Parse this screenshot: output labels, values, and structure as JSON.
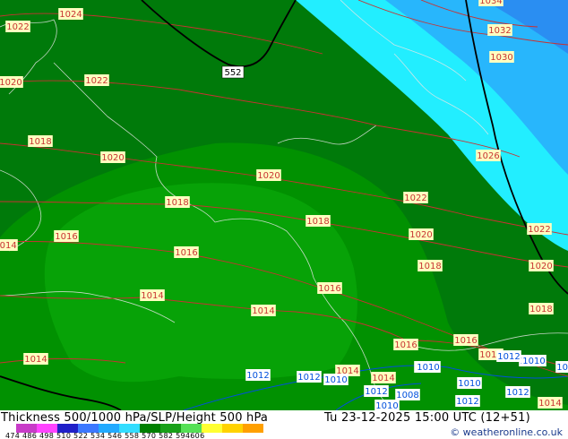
{
  "footer": {
    "title": "Thickness 500/1000 hPa/SLP/Height 500 hPa",
    "valid_time": "Tu 23-12-2025 15:00 UTC (12+51)",
    "credit": "© weatheronline.co.uk",
    "scale_ticks": "474 486 498 510 522 534 546 558 570 582 594606",
    "scale_colors": [
      "#c83cc8",
      "#ff44ff",
      "#2020c8",
      "#3c78ff",
      "#22aaff",
      "#33ddff",
      "#008000",
      "#19a019",
      "#55e055",
      "#ffff33",
      "#ffd200",
      "#ffa000"
    ]
  },
  "map": {
    "colors": {
      "dark_green": "#007a0a",
      "mid_green": "#019101",
      "light_green": "#07a207",
      "cyan": "#22eeff",
      "light_blue": "#28b6fc",
      "blue": "#2a8ef2",
      "isobar": "#c83232",
      "thickness_contour": "#0050dc",
      "height_contour": "#000000",
      "coast": "#e6e6e6"
    },
    "height_label": "552",
    "isobar_labels": [
      "1024",
      "1022",
      "1020",
      "1022",
      "1018",
      "1020",
      "1020",
      "1018",
      "1016",
      "1016",
      "1014",
      "1014",
      "1014",
      "1018",
      "1022",
      "1020",
      "1018",
      "1016",
      "1016",
      "1016",
      "1014",
      "1014",
      "1014",
      "1012",
      "1010",
      "1010",
      "1012",
      "1010",
      "1012",
      "1008",
      "1010",
      "1010",
      "1012",
      "1012",
      "1014",
      "1012",
      "1010",
      "1010",
      "1020",
      "1018",
      "1022",
      "1026",
      "1030",
      "1032",
      "1034",
      "1014",
      "1012"
    ]
  }
}
